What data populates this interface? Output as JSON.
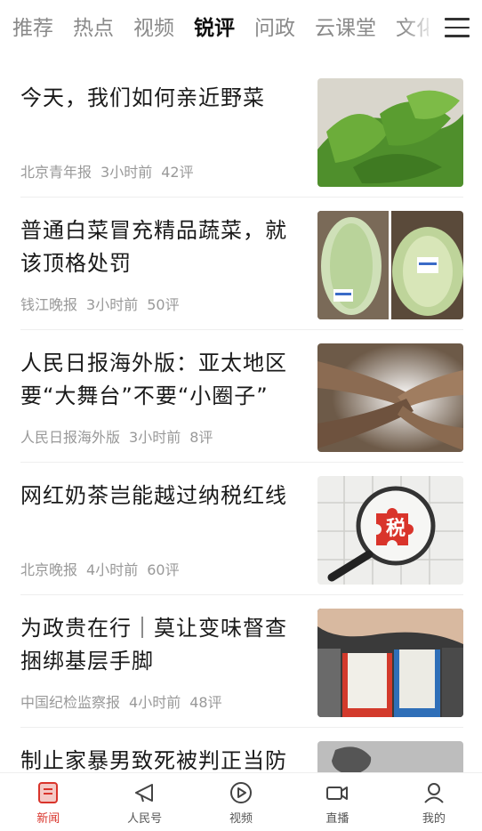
{
  "tabs": [
    {
      "label": "推荐",
      "active": false
    },
    {
      "label": "热点",
      "active": false
    },
    {
      "label": "视频",
      "active": false
    },
    {
      "label": "锐评",
      "active": true
    },
    {
      "label": "问政",
      "active": false
    },
    {
      "label": "云课堂",
      "active": false
    },
    {
      "label": "文化",
      "active": false
    }
  ],
  "articles": [
    {
      "title": "今天，我们如何亲近野菜",
      "source": "北京青年报",
      "time": "3小时前",
      "comments": "42评",
      "thumb_icon": "wild-vegetables-image"
    },
    {
      "title": "普通白菜冒充精品蔬菜，就该顶格处罚",
      "source": "钱江晚报",
      "time": "3小时前",
      "comments": "50评",
      "thumb_icon": "cabbage-image"
    },
    {
      "title": "人民日报海外版：亚太地区要“大舞台”不要“小圈子”",
      "source": "人民日报海外版",
      "time": "3小时前",
      "comments": "8评",
      "thumb_icon": "joined-arms-image"
    },
    {
      "title": "网红奶茶岂能越过纳税红线",
      "source": "北京晚报",
      "time": "4小时前",
      "comments": "60评",
      "thumb_icon": "tax-puzzle-image",
      "thumb_text": "税"
    },
    {
      "title": "为政贵在行｜莫让变味督查捆绑基层手脚",
      "source": "中国纪检监察报",
      "time": "4小时前",
      "comments": "48评",
      "thumb_icon": "binders-image"
    },
    {
      "title": "制止家暴男致死被判正当防",
      "source": "",
      "time": "",
      "comments": "",
      "thumb_icon": "fist-image"
    }
  ],
  "bottom_nav": [
    {
      "label": "新闻",
      "icon": "news-icon",
      "active": true
    },
    {
      "label": "人民号",
      "icon": "megaphone-icon",
      "active": false
    },
    {
      "label": "视频",
      "icon": "play-icon",
      "active": false
    },
    {
      "label": "直播",
      "icon": "camera-icon",
      "active": false
    },
    {
      "label": "我的",
      "icon": "user-icon",
      "active": false
    }
  ],
  "colors": {
    "accent": "#d9342b",
    "inactive_tab": "#8a8a8a",
    "meta": "#999999"
  }
}
